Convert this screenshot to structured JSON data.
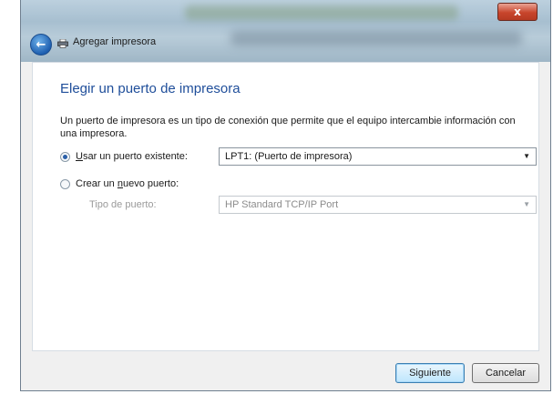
{
  "window": {
    "title": "Agregar impresora",
    "close_symbol": "x"
  },
  "content": {
    "heading": "Elegir un puerto de impresora",
    "description": "Un puerto de impresora es un tipo de conexión que permite que el equipo intercambie información con una impresora."
  },
  "options": {
    "existing": {
      "label_prefix": "",
      "label_mnemonic": "U",
      "label_rest": "sar un puerto existente:",
      "selected": true,
      "value": "LPT1: (Puerto de impresora)"
    },
    "new": {
      "label_prefix": "Crear un ",
      "label_mnemonic": "n",
      "label_rest": "uevo puerto:",
      "selected": false,
      "port_type_label": "Tipo de puerto:",
      "port_type_value": "HP Standard TCP/IP Port"
    }
  },
  "buttons": {
    "next": "Siguiente",
    "cancel": "Cancelar"
  },
  "icons": {
    "back": "back-arrow-icon",
    "printer": "printer-icon",
    "dropdown": "chevron-down-icon"
  }
}
